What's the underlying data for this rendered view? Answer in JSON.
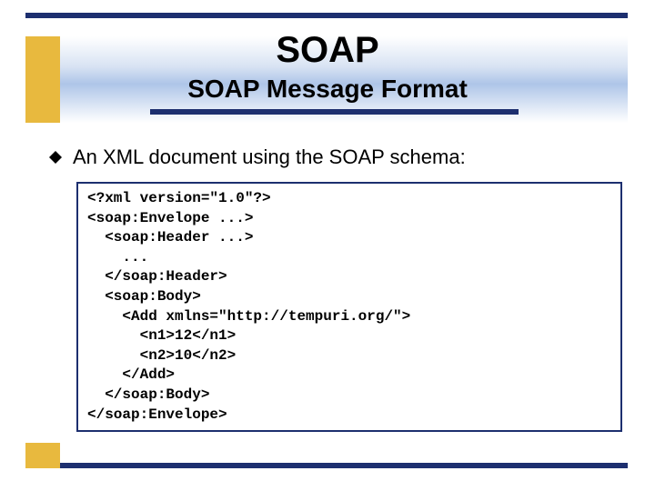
{
  "header": {
    "title_main": "SOAP",
    "title_sub": "SOAP Message Format"
  },
  "bullet": {
    "text": "An XML document using the SOAP schema:"
  },
  "code": {
    "lines": [
      "<?xml version=\"1.0\"?>",
      "<soap:Envelope ...>",
      "  <soap:Header ...>",
      "    ...",
      "  </soap:Header>",
      "  <soap:Body>",
      "    <Add xmlns=\"http://tempuri.org/\">",
      "      <n1>12</n1>",
      "      <n2>10</n2>",
      "    </Add>",
      "  </soap:Body>",
      "</soap:Envelope>"
    ]
  }
}
